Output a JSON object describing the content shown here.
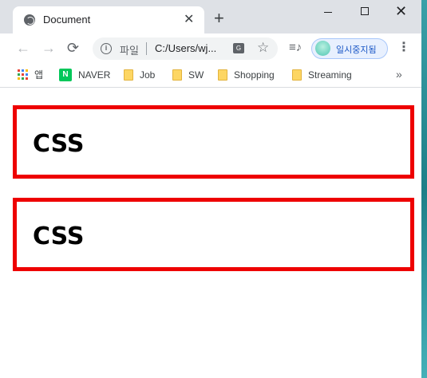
{
  "tab": {
    "title": "Document",
    "close": "✕",
    "new_tab": "+"
  },
  "window_controls": {
    "close": "✕"
  },
  "toolbar": {
    "back": "←",
    "forward": "→",
    "reload": "C",
    "info": "i",
    "scheme_label": "파일",
    "url": "C:/Users/wj...",
    "star": "☆",
    "media": "≡♪",
    "profile_label": "일시중지됨",
    "menu": "⋮"
  },
  "bookmarks": {
    "items": [
      {
        "label": "앱",
        "icon": "apps-icon"
      },
      {
        "label": "NAVER",
        "icon": "naver-icon"
      },
      {
        "label": "Job",
        "icon": "folder-icon"
      },
      {
        "label": "SW",
        "icon": "folder-icon"
      },
      {
        "label": "Shopping",
        "icon": "folder-icon"
      },
      {
        "label": "Streaming",
        "icon": "folder-icon"
      }
    ],
    "more": "»",
    "naver_glyph": "N"
  },
  "content": {
    "boxes": [
      {
        "text": "CSS"
      },
      {
        "text": "CSS"
      }
    ],
    "box_border_color": "#ee0000"
  },
  "colors": {
    "tabbar": "#dee1e6",
    "accent": "#1a57c6"
  }
}
